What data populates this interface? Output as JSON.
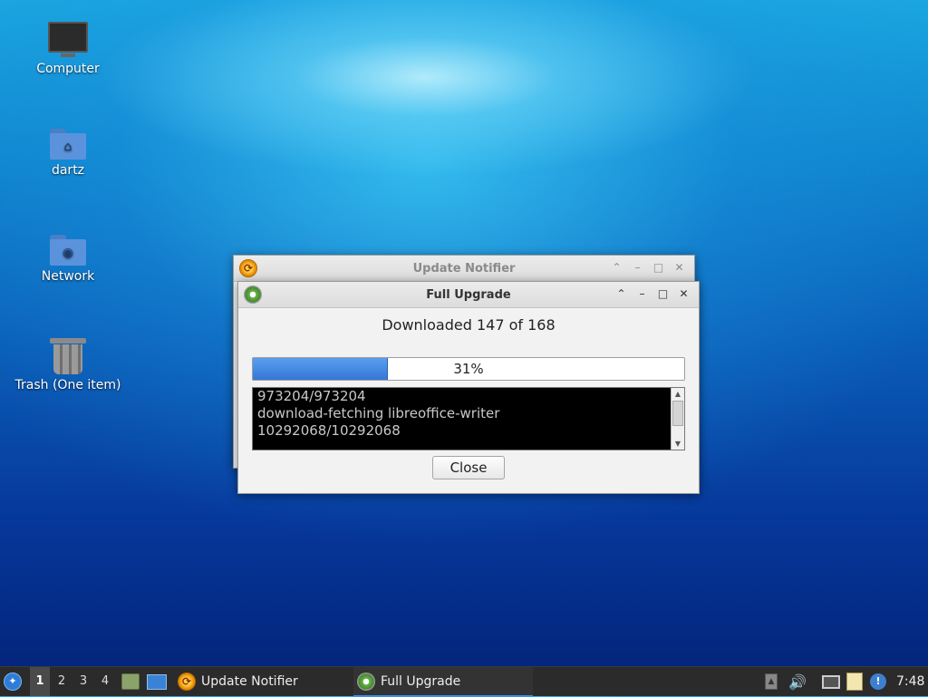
{
  "desktop": {
    "icons": [
      {
        "label": "Computer"
      },
      {
        "label": "dartz"
      },
      {
        "label": "Network"
      },
      {
        "label": "Trash (One item)"
      }
    ]
  },
  "update_notifier": {
    "title": "Update Notifier"
  },
  "full_upgrade": {
    "title": "Full Upgrade",
    "status": "Downloaded 147 of 168",
    "progress": 0.31,
    "progress_label": "31%",
    "log_text": "973204/973204\ndownload-fetching libreoffice-writer\n10292068/10292068",
    "close_label": "Close"
  },
  "taskbar": {
    "workspaces": [
      "1",
      "2",
      "3",
      "4"
    ],
    "tasks": [
      {
        "label": "Update Notifier"
      },
      {
        "label": "Full Upgrade"
      }
    ],
    "clock": "7:48"
  },
  "colors": {
    "progress_fill": "#3d86e0",
    "taskbar_bg": "#2b2b2b",
    "active_task_accent": "#3d8ee8"
  }
}
